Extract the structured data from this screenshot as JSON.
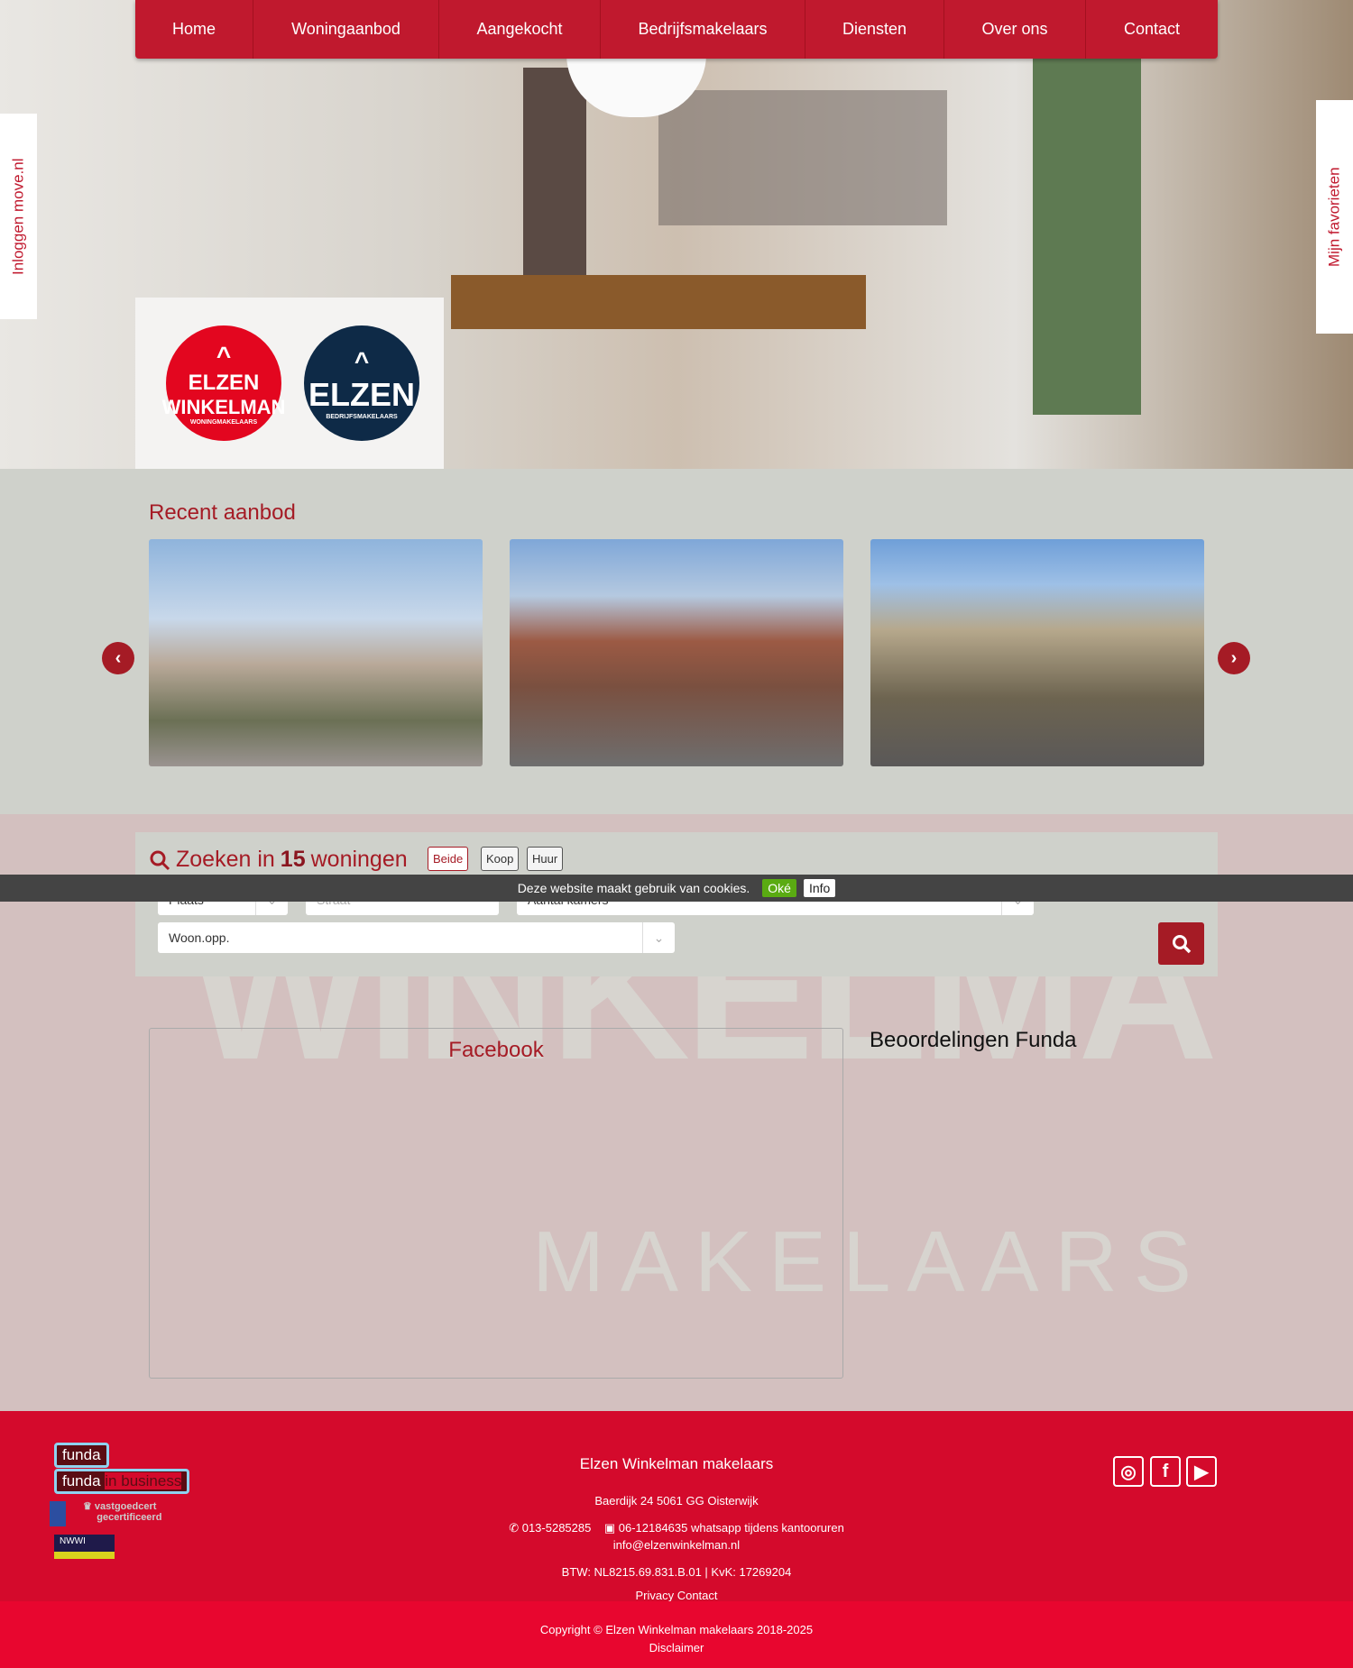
{
  "nav": {
    "items": [
      "Home",
      "Woningaanbod",
      "Aangekocht",
      "Bedrijfsmakelaars",
      "Diensten",
      "Over ons",
      "Contact"
    ]
  },
  "side_tabs": {
    "login": "Inloggen move.nl",
    "favorites": "Mijn favorieten"
  },
  "logos": {
    "left": {
      "line1": "ELZEN",
      "line2": "WINKELMAN",
      "line3": "WONINGMAKELAARS",
      "color": "#e3061f"
    },
    "right": {
      "line1": "ELZEN",
      "line2": "BEDRIJFSMAKELAARS",
      "color": "#0e2a47"
    }
  },
  "recent": {
    "title": "Recent aanbod",
    "prev_icon": "chevron-left-icon",
    "next_icon": "chevron-right-icon"
  },
  "background_text": {
    "line1": "WINKELMA",
    "line2": "MAKELAARS"
  },
  "search": {
    "prefix": "Zoeken in",
    "count": "15",
    "suffix": "woningen",
    "types": [
      "Beide",
      "Koop",
      "Huur"
    ],
    "active_type": "Beide",
    "fields": {
      "plaats": "Plaats",
      "straat": "Straat",
      "kamers": "Aantal kamers",
      "woonopp": "Woon.opp."
    }
  },
  "cookie": {
    "text": "Deze website maakt gebruik van cookies.",
    "ok": "Oké",
    "info": "Info"
  },
  "facebook": {
    "title": "Facebook"
  },
  "funda": {
    "title": "Beoordelingen Funda"
  },
  "footer": {
    "company": "Elzen Winkelman makelaars",
    "address": "Baerdijk 24   5061 GG Oisterwijk",
    "phone": "013-5285285",
    "mobile": "06-12184635 whatsapp tijdens kantooruren",
    "email": "info@elzenwinkelman.nl",
    "btw": "BTW: NL8215.69.831.B.01 | KvK: 17269204",
    "links": "Privacy Contact",
    "badges": {
      "funda": "funda",
      "funda_business": "in business",
      "vastgoedcert": "vastgoedcert",
      "vastgoedcert_sub": "gecertificeerd",
      "nwwi": "NWWI"
    },
    "copyright": "Copyright © Elzen Winkelman makelaars 2018-2025",
    "disclaimer": "Disclaimer"
  },
  "colors": {
    "brand_red": "#c0192e",
    "footer": "#d40a2c",
    "accent": "#a51b25"
  }
}
